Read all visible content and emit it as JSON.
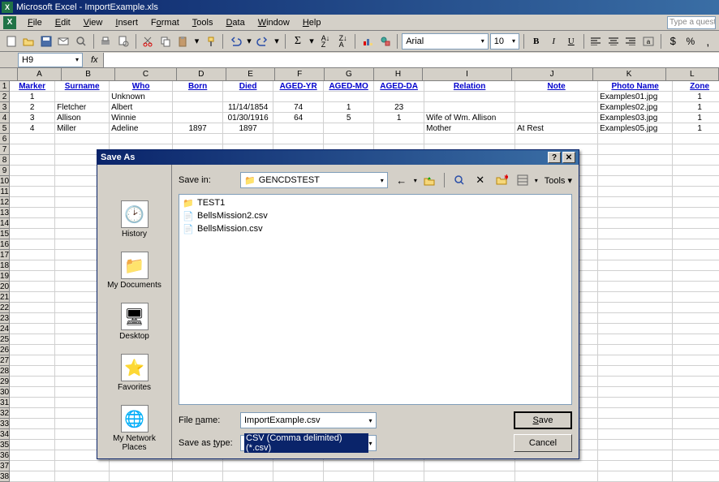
{
  "title": "Microsoft Excel - ImportExample.xls",
  "menus": [
    "File",
    "Edit",
    "View",
    "Insert",
    "Format",
    "Tools",
    "Data",
    "Window",
    "Help"
  ],
  "ask_placeholder": "Type a quest",
  "font": "Arial",
  "font_size": "10",
  "name_box": "H9",
  "fx": "fx",
  "headers": [
    "Marker",
    "Surname",
    "Who",
    "Born",
    "Died",
    "AGED-YR",
    "AGED-MO",
    "AGED-DA",
    "Relation",
    "Note",
    "Photo Name",
    "Zone"
  ],
  "rows": [
    {
      "n": "1",
      "marker": "1",
      "surname": "",
      "who": "Unknown",
      "born": "",
      "died": "",
      "yr": "",
      "mo": "",
      "da": "",
      "rel": "",
      "note": "",
      "photo": "Examples01.jpg",
      "zone": "1"
    },
    {
      "n": "2",
      "marker": "2",
      "surname": "Fletcher",
      "who": "Albert",
      "born": "",
      "died": "11/14/1854",
      "yr": "74",
      "mo": "1",
      "da": "23",
      "rel": "",
      "note": "",
      "photo": "Examples02.jpg",
      "zone": "1"
    },
    {
      "n": "3",
      "marker": "3",
      "surname": "Allison",
      "who": "Winnie",
      "born": "",
      "died": "01/30/1916",
      "yr": "64",
      "mo": "5",
      "da": "1",
      "rel": "Wife of Wm. Allison",
      "note": "",
      "photo": "Examples03.jpg",
      "zone": "1"
    },
    {
      "n": "4",
      "marker": "4",
      "surname": "Miller",
      "who": "Adeline",
      "born": "1897",
      "died": "1897",
      "yr": "",
      "mo": "",
      "da": "",
      "rel": "Mother",
      "note": "At Rest",
      "photo": "Examples05.jpg",
      "zone": "1"
    }
  ],
  "dialog": {
    "title": "Save As",
    "save_in_label": "Save in:",
    "save_in_value": "GENCDSTEST",
    "tools_label": "Tools",
    "sidebar": [
      {
        "label": "History",
        "icon": "🕑"
      },
      {
        "label": "My Documents",
        "icon": "📁"
      },
      {
        "label": "Desktop",
        "icon": "🖥"
      },
      {
        "label": "Favorites",
        "icon": "⭐"
      },
      {
        "label": "My Network Places",
        "icon": "🌐"
      }
    ],
    "files": [
      {
        "name": "TEST1",
        "type": "folder"
      },
      {
        "name": "BellsMission2.csv",
        "type": "csv"
      },
      {
        "name": "BellsMission.csv",
        "type": "csv"
      }
    ],
    "filename_label": "File name:",
    "filename_value": "ImportExample.csv",
    "type_label": "Save as type:",
    "type_value": "CSV (Comma delimited) (*.csv)",
    "save_btn": "Save",
    "cancel_btn": "Cancel"
  }
}
